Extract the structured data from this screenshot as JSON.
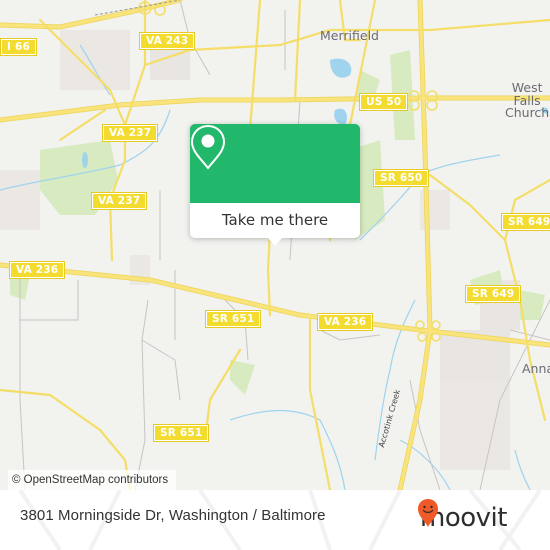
{
  "map": {
    "road_shields": [
      {
        "id": "i66",
        "label": "I 66"
      },
      {
        "id": "va243",
        "label": "VA 243"
      },
      {
        "id": "us50",
        "label": "US 50"
      },
      {
        "id": "va237a",
        "label": "VA 237"
      },
      {
        "id": "va237b",
        "label": "VA 237"
      },
      {
        "id": "sr650",
        "label": "SR 650"
      },
      {
        "id": "sr649a",
        "label": "SR 649"
      },
      {
        "id": "sr649b",
        "label": "SR 649"
      },
      {
        "id": "va236a",
        "label": "VA 236"
      },
      {
        "id": "va236b",
        "label": "VA 236"
      },
      {
        "id": "sr651a",
        "label": "SR 651"
      },
      {
        "id": "sr651b",
        "label": "SR 651"
      }
    ],
    "places": {
      "merrifield": "Merrifield",
      "west_falls_church": [
        "West",
        "Falls",
        "Church"
      ],
      "annandale": "Anna"
    },
    "water_label": "Accotink Creek",
    "attribution": "© OpenStreetMap contributors",
    "colors": {
      "background": "#f2f2ef",
      "road": "#f6e06a",
      "park": "#d8ebc0",
      "water": "#9fd3ee",
      "shield": "#f3dc2f"
    }
  },
  "popup": {
    "icon": "map-pin-icon",
    "button_label": "Take me there",
    "color": "#21b86b"
  },
  "footer": {
    "address": "3801 Morningside Dr, Washington / Baltimore",
    "brand": "moovit",
    "brand_color": "#f05a28"
  }
}
